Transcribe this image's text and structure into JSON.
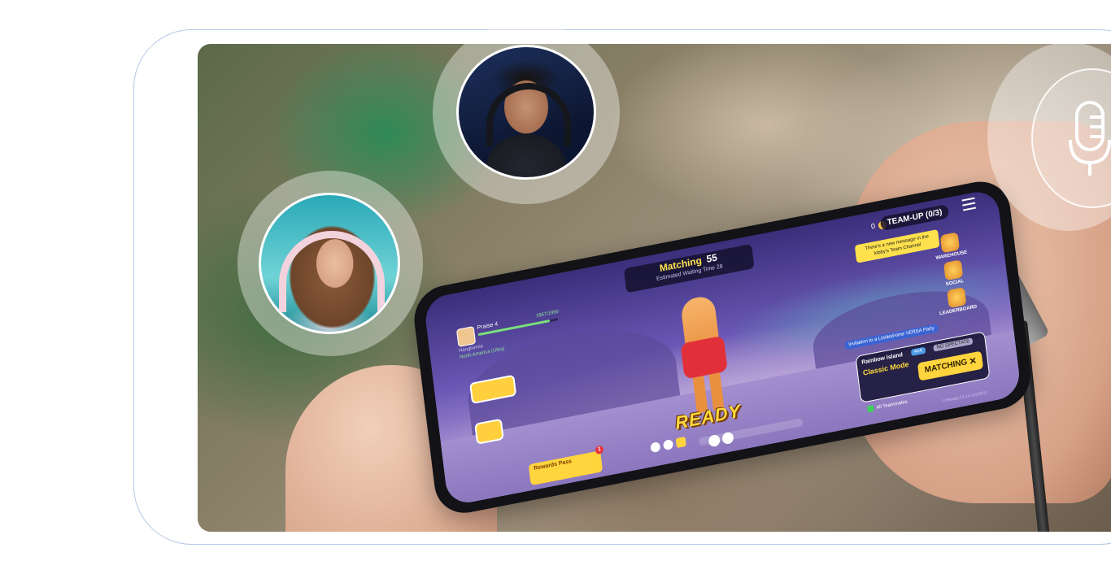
{
  "hero": {
    "alt": "Player holding phone with team game matching screen and voice chat participants"
  },
  "game": {
    "matching_label": "Matching",
    "matching_count": "55",
    "waiting_text": "Estimated Waiting Time 28",
    "team_up_label": "TEAM-UP (0/3)",
    "coin_count": "0",
    "new_message_tip": "There's a new message in the lobby's Team Channel",
    "player_name": "Praise 4",
    "player_level": "1867/1990",
    "player_id": "Hangbinnie",
    "server": "North America (Ultra)",
    "sidebar": [
      {
        "label": "WAREHOUSE"
      },
      {
        "label": "SOCIAL"
      },
      {
        "label": "LEADERBOARD"
      }
    ],
    "ready_label": "READY",
    "invite_text": "Invitation to a Limited-time VERSA Party",
    "map_name": "Rainbow Island",
    "mode_tag_1": "4v4",
    "mode_tag_2": "NO SPECTATE",
    "mode_name": "Classic Mode",
    "matching_button": "MATCHING",
    "close_symbol": "✕",
    "teammates_label": "All Teammates",
    "version": "1.0Ready-13.14.14(4091)",
    "reward_label": "Rewards Pass",
    "reward_badge": "1"
  },
  "icons": {
    "mic": "microphone-icon"
  },
  "colors": {
    "frame_border": "#b8c8e8",
    "accent_yellow": "#ffd43d",
    "game_purple": "#6a58b5"
  }
}
